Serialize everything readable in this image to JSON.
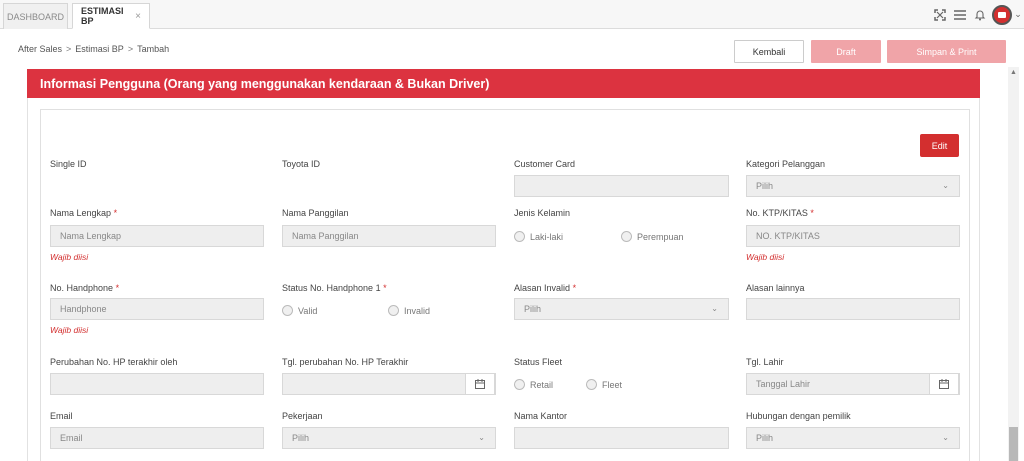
{
  "tabs": {
    "dashboard": "DASHBOARD",
    "estimasi": "ESTIMASI BP",
    "close": "×"
  },
  "top_icons": [
    "expand-icon",
    "menu-icon",
    "bell-icon",
    "avatar",
    "chevron-down-icon"
  ],
  "breadcrumb": {
    "a": "After Sales",
    "b": "Estimasi BP",
    "c": "Tambah",
    "sep": ">"
  },
  "actions": {
    "kembali": "Kembali",
    "draft": "Draft",
    "simpan": "Simpan & Print"
  },
  "panel": {
    "title": "Informasi Pengguna (Orang yang menggunakan kendaraan & Bukan Driver)",
    "edit": "Edit"
  },
  "form": {
    "single_id": "Single ID",
    "toyota_id": "Toyota ID",
    "customer_card": "Customer Card",
    "kategori": "Kategori Pelanggan",
    "kategori_value": "Pilih",
    "nama_lengkap": "Nama Lengkap",
    "nama_lengkap_ph": "Nama Lengkap",
    "nama_panggilan": "Nama Panggilan",
    "nama_panggilan_ph": "Nama Panggilan",
    "jenis_kelamin": "Jenis Kelamin",
    "laki": "Laki-laki",
    "perempuan": "Perempuan",
    "ktp": "No. KTP/KITAS",
    "ktp_ph": "NO. KTP/KITAS",
    "handphone": "No. Handphone",
    "handphone_ph": "Handphone",
    "status_hp": "Status No. Handphone 1",
    "valid": "Valid",
    "invalid": "Invalid",
    "alasan_invalid": "Alasan Invalid",
    "alasan_invalid_value": "Pilih",
    "alasan_lain": "Alasan lainnya",
    "perubahan_oleh": "Perubahan No. HP terakhir oleh",
    "tgl_perubahan": "Tgl. perubahan No. HP Terakhir",
    "status_fleet": "Status Fleet",
    "retail": "Retail",
    "fleet": "Fleet",
    "tgl_lahir": "Tgl. Lahir",
    "tgl_lahir_ph": "Tanggal Lahir",
    "email": "Email",
    "email_ph": "Email",
    "pekerjaan": "Pekerjaan",
    "pekerjaan_value": "Pilih",
    "nama_kantor": "Nama Kantor",
    "hubungan": "Hubungan dengan pemilik",
    "hubungan_value": "Pilih",
    "required_mark": "*",
    "wajib": "Wajib diisi"
  },
  "colors": {
    "accent": "#dc3340",
    "button_disabled": "#f0a4a8",
    "error": "#d32f2f"
  }
}
